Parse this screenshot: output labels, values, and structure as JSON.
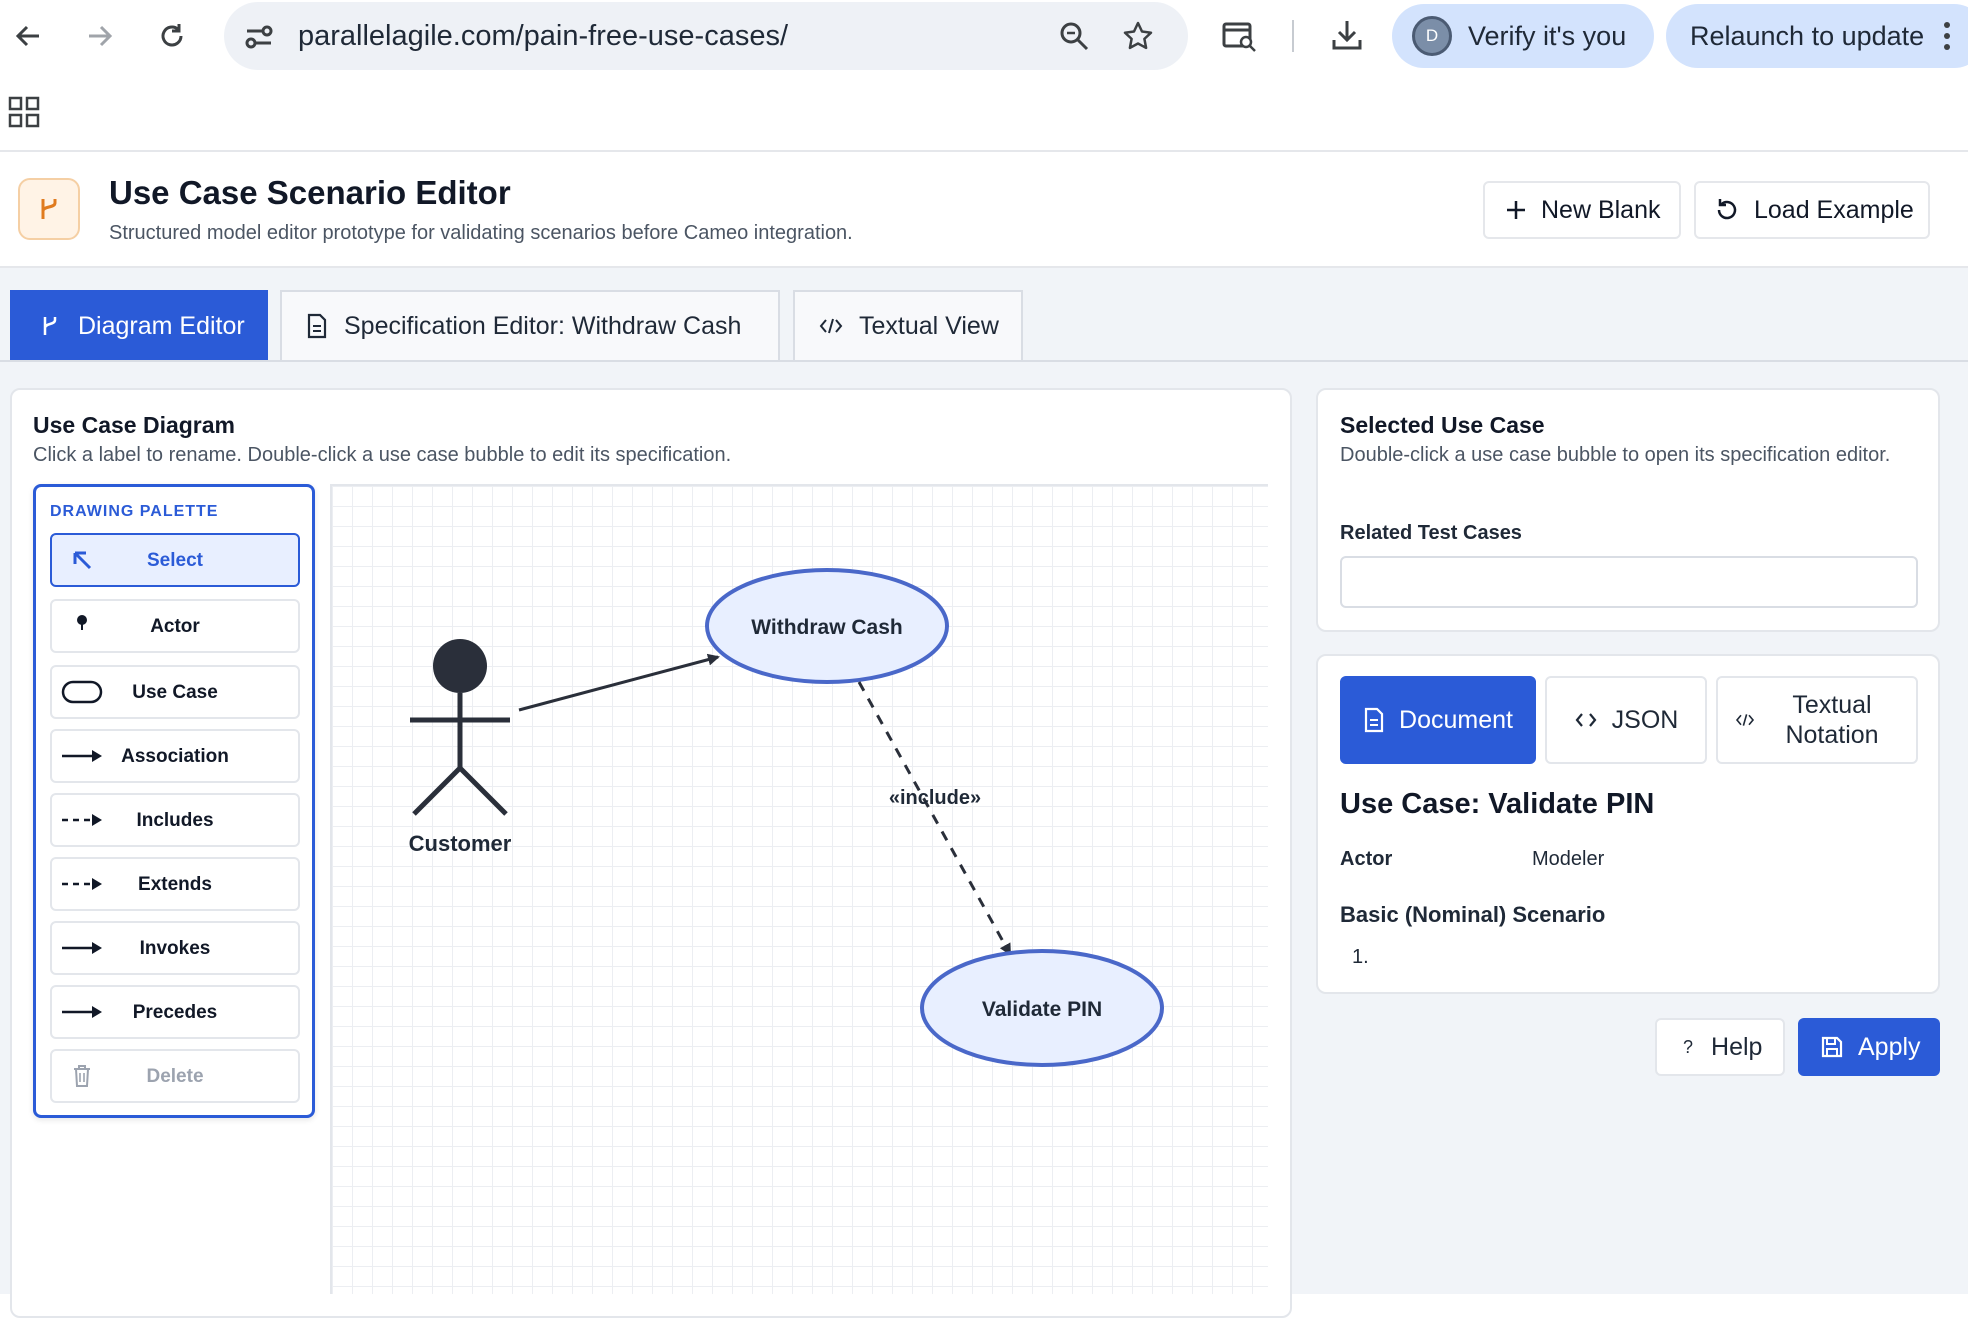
{
  "browser": {
    "url": "parallelagile.com/pain-free-use-cases/",
    "verify_label": "Verify it's you",
    "verify_avatar_letter": "D",
    "relaunch_label": "Relaunch to update"
  },
  "header": {
    "title": "Use Case Scenario Editor",
    "subtitle": "Structured model editor prototype for validating scenarios before Cameo integration.",
    "new_blank_label": "New Blank",
    "load_example_label": "Load Example"
  },
  "tabs": [
    {
      "label": "Diagram Editor",
      "active": true
    },
    {
      "label": "Specification Editor: Withdraw Cash",
      "active": false
    },
    {
      "label": "Textual View",
      "active": false
    }
  ],
  "diagram_card": {
    "title": "Use Case Diagram",
    "subtitle": "Click a label to rename. Double-click a use case bubble to edit its specification."
  },
  "palette": {
    "title": "DRAWING PALETTE",
    "items": [
      {
        "label": "Select",
        "icon": "select-arrow-icon",
        "selected": true
      },
      {
        "label": "Actor",
        "icon": "actor-icon"
      },
      {
        "label": "Use Case",
        "icon": "use-case-icon"
      },
      {
        "label": "Association",
        "icon": "association-arrow-icon"
      },
      {
        "label": "Includes",
        "icon": "includes-arrow-icon"
      },
      {
        "label": "Extends",
        "icon": "extends-arrow-icon"
      },
      {
        "label": "Invokes",
        "icon": "invokes-arrow-icon"
      },
      {
        "label": "Precedes",
        "icon": "precedes-arrow-icon"
      },
      {
        "label": "Delete",
        "icon": "trash-icon",
        "disabled": true
      }
    ]
  },
  "diagram": {
    "actor_name": "Customer",
    "use_case_1": "Withdraw Cash",
    "use_case_2": "Validate PIN",
    "include_label": "«include»"
  },
  "selected_card": {
    "title": "Selected Use Case",
    "subtitle": "Double-click a use case bubble to open its specification editor.",
    "related_label": "Related Test Cases",
    "related_value": ""
  },
  "spec_view": {
    "document_label": "Document",
    "json_label": "JSON",
    "textual_label_line1": "Textual",
    "textual_label_line2": "Notation",
    "heading": "Use Case: Validate PIN",
    "actor_key": "Actor",
    "actor_value": "Modeler",
    "scenario_heading": "Basic (Nominal) Scenario",
    "scenario_step": "1."
  },
  "actions": {
    "help_label": "Help",
    "apply_label": "Apply"
  },
  "colors": {
    "accent": "#2b5bd7",
    "bubble_fill": "#e8efff",
    "bubble_stroke": "#4a68c9",
    "actor": "#2a2f3a"
  }
}
